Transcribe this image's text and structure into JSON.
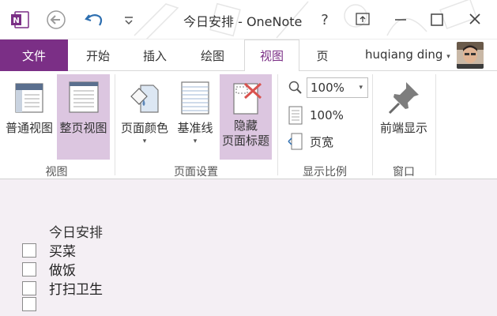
{
  "window": {
    "title": "今日安排 - OneNote",
    "help_label": "?"
  },
  "tabs": {
    "file": "文件",
    "home": "开始",
    "insert": "插入",
    "draw": "绘图",
    "view": "视图",
    "page": "页"
  },
  "user": {
    "name": "huqiang ding"
  },
  "ribbon": {
    "view_group": {
      "label": "视图",
      "normal_view": "普通视图",
      "full_page_view": "整页视图"
    },
    "page_setup_group": {
      "label": "页面设置",
      "page_color": "页面颜色",
      "rule_lines": "基准线",
      "hide_title_line1": "隐藏",
      "hide_title_line2": "页面标题"
    },
    "zoom_group": {
      "label": "显示比例",
      "zoom_value": "100%",
      "zoom_100": "100%",
      "page_width": "页宽"
    },
    "window_group": {
      "label": "窗口",
      "always_on_top": "前端显示"
    }
  },
  "page": {
    "title": "今日安排",
    "todos": [
      {
        "text": "买菜",
        "checked": false
      },
      {
        "text": "做饭",
        "checked": false
      },
      {
        "text": "打扫卫生",
        "checked": false
      },
      {
        "text": "",
        "checked": false
      }
    ]
  },
  "colors": {
    "accent": "#7b2f86",
    "highlight": "#dcc6e0",
    "page_bg": "#f4eff4"
  }
}
